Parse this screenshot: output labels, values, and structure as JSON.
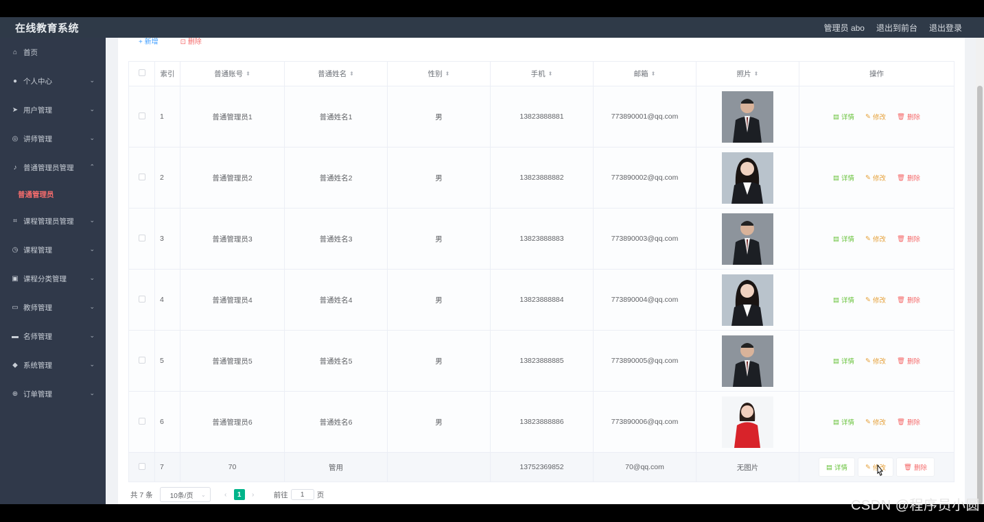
{
  "app": {
    "title": "在线教育系统"
  },
  "header": {
    "user_label": "管理员 abo",
    "front_link": "退出到前台",
    "logout_link": "退出登录"
  },
  "sidebar": {
    "items": [
      {
        "label": "首页",
        "icon": "home-icon",
        "has_chevron": false
      },
      {
        "label": "个人中心",
        "icon": "user-icon",
        "has_chevron": true
      },
      {
        "label": "用户管理",
        "icon": "send-icon",
        "has_chevron": true
      },
      {
        "label": "讲师管理",
        "icon": "compass-icon",
        "has_chevron": true
      },
      {
        "label": "普通管理员管理",
        "icon": "microphone-icon",
        "has_chevron": true,
        "expanded": true
      },
      {
        "label": "课程管理员管理",
        "icon": "crop-icon",
        "has_chevron": true
      },
      {
        "label": "课程管理",
        "icon": "clock-icon",
        "has_chevron": true
      },
      {
        "label": "课程分类管理",
        "icon": "clipboard-icon",
        "has_chevron": true
      },
      {
        "label": "教师管理",
        "icon": "monitor-icon",
        "has_chevron": true
      },
      {
        "label": "名师管理",
        "icon": "chat-icon",
        "has_chevron": true
      },
      {
        "label": "系统管理",
        "icon": "location-icon",
        "has_chevron": true
      },
      {
        "label": "订单管理",
        "icon": "globe-icon",
        "has_chevron": true
      }
    ],
    "active_sub": "普通管理员"
  },
  "toolbar": {
    "add_label": "+ 新增",
    "delete_label": "删除"
  },
  "table": {
    "headers": [
      "索引",
      "普通账号",
      "普通姓名",
      "性别",
      "手机",
      "邮箱",
      "照片",
      "操作"
    ],
    "rows": [
      {
        "index": "1",
        "account": "普通管理员1",
        "name": "普通姓名1",
        "gender": "男",
        "phone": "13823888881",
        "email": "773890001@qq.com",
        "photo": "man-suit"
      },
      {
        "index": "2",
        "account": "普通管理员2",
        "name": "普通姓名2",
        "gender": "男",
        "phone": "13823888882",
        "email": "773890002@qq.com",
        "photo": "woman-suit"
      },
      {
        "index": "3",
        "account": "普通管理员3",
        "name": "普通姓名3",
        "gender": "男",
        "phone": "13823888883",
        "email": "773890003@qq.com",
        "photo": "man-suit"
      },
      {
        "index": "4",
        "account": "普通管理员4",
        "name": "普通姓名4",
        "gender": "男",
        "phone": "13823888884",
        "email": "773890004@qq.com",
        "photo": "woman-suit"
      },
      {
        "index": "5",
        "account": "普通管理员5",
        "name": "普通姓名5",
        "gender": "男",
        "phone": "13823888885",
        "email": "773890005@qq.com",
        "photo": "man-suit"
      },
      {
        "index": "6",
        "account": "普通管理员6",
        "name": "普通姓名6",
        "gender": "男",
        "phone": "13823888886",
        "email": "773890006@qq.com",
        "photo": "woman-red"
      },
      {
        "index": "7",
        "account": "70",
        "name": "管用",
        "gender": "",
        "phone": "13752369852",
        "email": "70@qq.com",
        "photo": "none",
        "photo_text": "无图片"
      }
    ],
    "ops": {
      "detail": "详情",
      "edit": "修改",
      "delete": "删除"
    }
  },
  "pagination": {
    "total": "共 7 条",
    "page_size": "10条/页",
    "current": "1",
    "goto_label": "前往",
    "goto_value": "1",
    "page_suffix": "页"
  },
  "watermark": "CSDN @程序员小圆",
  "colors": {
    "sidebar_bg": "#30394a",
    "topbar_bg": "#2f3a48",
    "active_red": "#f56c6c",
    "detail_green": "#67c23a",
    "edit_orange": "#e6a23c",
    "pager_active": "#00b48a"
  }
}
